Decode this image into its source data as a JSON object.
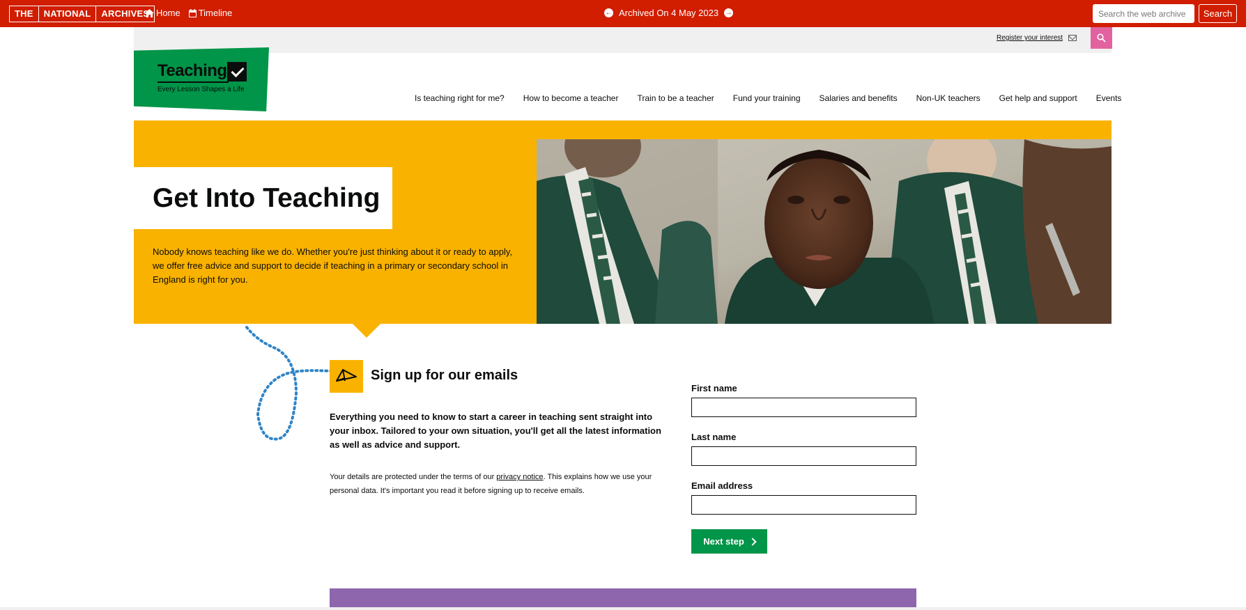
{
  "archive_bar": {
    "logo_parts": [
      "THE",
      "NATIONAL",
      "ARCHIVES"
    ],
    "home_label": "Home",
    "timeline_label": "Timeline",
    "archived_text": "Archived On 4 May 2023",
    "search_placeholder": "Search the web archive",
    "search_button": "Search"
  },
  "utility_bar": {
    "register_label": "Register your interest"
  },
  "logo": {
    "word": "Teaching",
    "tagline": "Every Lesson Shapes a Life"
  },
  "main_nav": {
    "items": [
      "Is teaching right for me?",
      "How to become a teacher",
      "Train to be a teacher",
      "Fund your training",
      "Salaries and benefits",
      "Non-UK teachers",
      "Get help and support",
      "Events"
    ]
  },
  "hero": {
    "title": "Get Into Teaching",
    "text": "Nobody knows teaching like we do. Whether you're just thinking about it or ready to apply, we offer free advice and support to decide if teaching in a primary or secondary school in England is right for you."
  },
  "signup": {
    "title": "Sign up for our emails",
    "lead": "Everything you need to know to start a career in teaching sent straight into your inbox. Tailored to your own situation, you'll get all the latest information as well as advice and support.",
    "note_before": "Your details are protected under the terms of our ",
    "note_link": "privacy notice",
    "note_after": ". This explains how we use your personal data. It's important you read it before signing up to receive emails.",
    "first_name_label": "First name",
    "last_name_label": "Last name",
    "email_label": "Email address",
    "next_button": "Next step"
  },
  "colors": {
    "archive_red": "#d11d00",
    "brand_green": "#009548",
    "hero_yellow": "#f9b200",
    "search_pink": "#e2629f",
    "band_purple": "#8d66ae"
  }
}
